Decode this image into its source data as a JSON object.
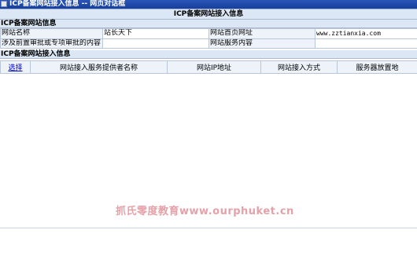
{
  "window": {
    "title": "ICP备案网站接入信息 -- 网页对话框"
  },
  "main": {
    "header": "ICP备案网站接入信息"
  },
  "site_info": {
    "section_title": "ICP备案网站信息",
    "rows": [
      {
        "label1": "网站名称",
        "value1": "站长天下",
        "label2": "网站首页网址",
        "value2": "www.zztianxia.com"
      },
      {
        "label1": "涉及前置审批或专项审批的内容",
        "value1": "",
        "label2": "网站服务内容",
        "value2": ""
      }
    ]
  },
  "access_info": {
    "section_title": "ICP备案网站接入信息",
    "columns": [
      "选择",
      "网站接入服务提供者名称",
      "网站IP地址",
      "网站接入方式",
      "服务器放置地"
    ]
  },
  "watermark": "抓氏零度教育www.ourphuket.cn"
}
